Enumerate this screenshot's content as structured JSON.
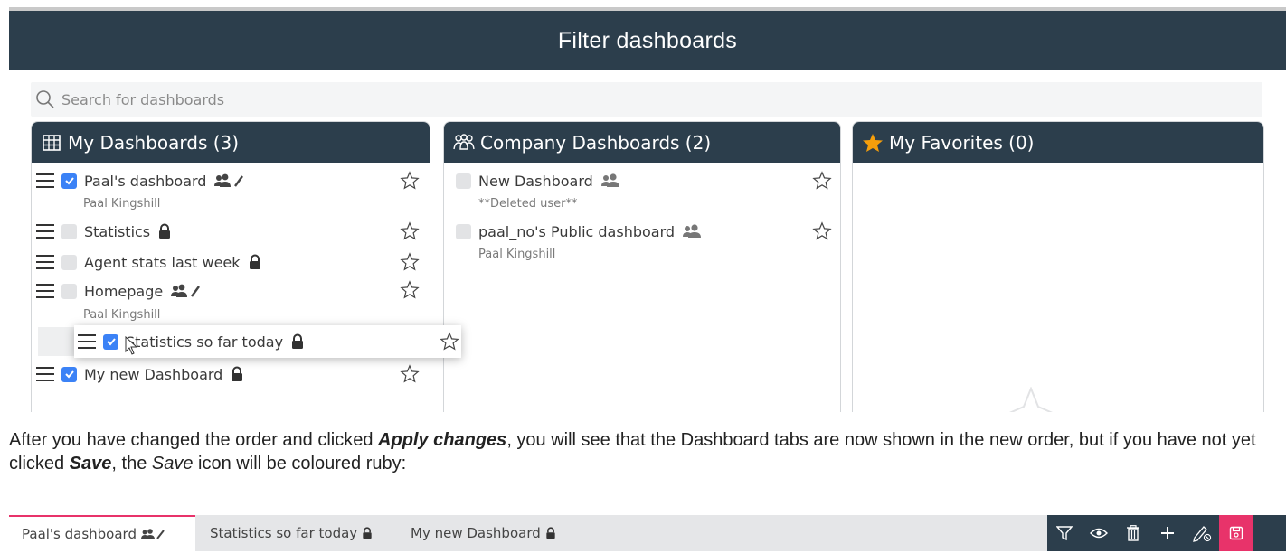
{
  "modal": {
    "title": "Filter dashboards",
    "search_placeholder": "Search for dashboards"
  },
  "columns": {
    "my": {
      "title": "My Dashboards (3)",
      "items": [
        {
          "label": "Paal's dashboard",
          "owner": "Paal Kingshill",
          "checked": true,
          "icon": "shared-edit-icon"
        },
        {
          "label": "Statistics",
          "checked": false,
          "icon": "lock-icon"
        },
        {
          "label": "Agent stats last week",
          "checked": false,
          "icon": "lock-icon"
        },
        {
          "label": "Homepage",
          "owner": "Paal Kingshill",
          "checked": false,
          "icon": "shared-edit-icon"
        },
        {
          "label": "Statistics so far today",
          "checked": true,
          "icon": "lock-icon",
          "dragging": true
        },
        {
          "label": "My new Dashboard",
          "checked": true,
          "icon": "lock-icon"
        }
      ]
    },
    "company": {
      "title": "Company Dashboards (2)",
      "items": [
        {
          "label": "New Dashboard",
          "owner": "**Deleted user**",
          "checked": false,
          "icon": "shared-icon"
        },
        {
          "label": "paal_no's Public dashboard",
          "owner": "Paal Kingshill",
          "checked": false,
          "icon": "shared-icon"
        }
      ]
    },
    "favorites": {
      "title": "My Favorites (0)"
    }
  },
  "caption": {
    "p1": "After you have changed the order and clicked ",
    "b1": "Apply changes",
    "p2": ", you will see that the Dashboard tabs are now shown in the new order, but if you have not yet clicked ",
    "b2": "Save",
    "p3": ", the ",
    "i1": "Save",
    "p4": " icon will be coloured ruby:"
  },
  "tabs": [
    {
      "label": "Paal's dashboard",
      "active": true,
      "icon": "shared-edit-icon"
    },
    {
      "label": "Statistics so far today",
      "active": false,
      "icon": "lock-icon"
    },
    {
      "label": "My new Dashboard",
      "active": false,
      "icon": "lock-icon"
    }
  ],
  "toolbar": [
    "filter-icon",
    "eye-icon",
    "trash-icon",
    "plus-icon",
    "edit-off-icon",
    "save-icon"
  ],
  "colors": {
    "header": "#2c3e4c",
    "accent_ruby": "#e8336a",
    "checkbox": "#3b82f6",
    "favorite_star": "#f59e0b"
  }
}
